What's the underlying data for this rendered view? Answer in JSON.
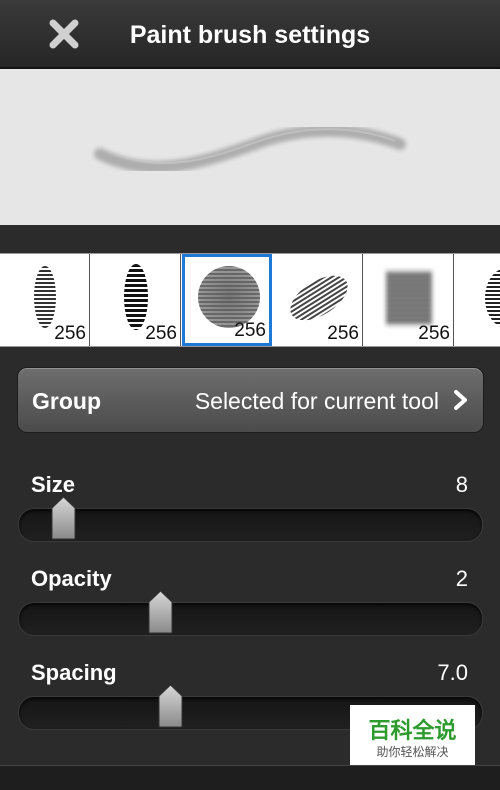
{
  "header": {
    "title": "Paint brush settings",
    "close_icon": "close-icon"
  },
  "brushes": [
    {
      "size": "256",
      "selected": false,
      "icon": "narrow-ellipse-brush-icon"
    },
    {
      "size": "256",
      "selected": false,
      "icon": "striped-ellipse-brush-icon"
    },
    {
      "size": "256",
      "selected": true,
      "icon": "round-brush-icon"
    },
    {
      "size": "256",
      "selected": false,
      "icon": "slanted-ellipse-brush-icon"
    },
    {
      "size": "256",
      "selected": false,
      "icon": "square-blur-brush-icon"
    },
    {
      "size": "",
      "selected": false,
      "icon": "partial-brush-icon"
    }
  ],
  "group": {
    "label": "Group",
    "value": "Selected for current tool"
  },
  "sliders": {
    "size": {
      "label": "Size",
      "value": "8"
    },
    "opacity": {
      "label": "Opacity",
      "value": "2"
    },
    "spacing": {
      "label": "Spacing",
      "value": "7.0"
    }
  },
  "watermark": {
    "main": "百科全说",
    "sub": "助你轻松解决"
  },
  "colors": {
    "accent": "#1f79d6",
    "background": "#2b2b2b"
  }
}
